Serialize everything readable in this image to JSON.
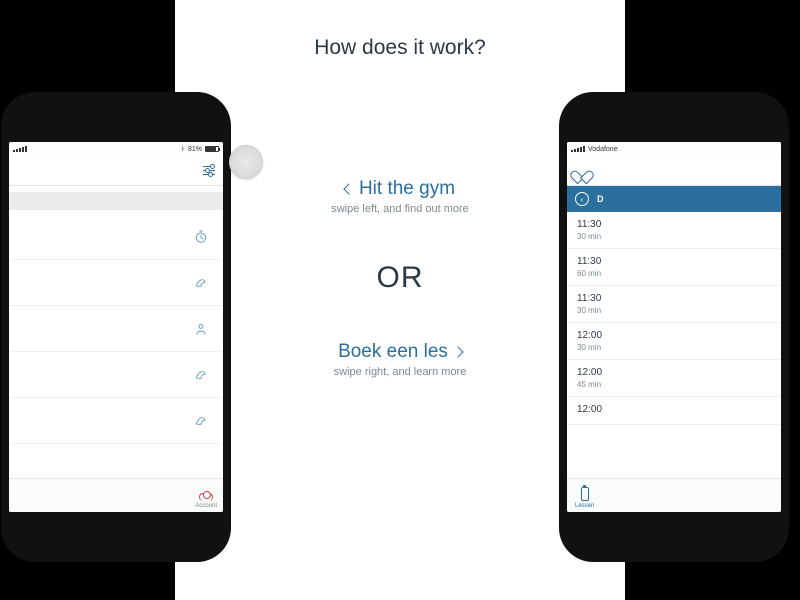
{
  "heading": "How does it work?",
  "center": {
    "left_cta_title": "Hit the gym",
    "left_cta_sub": "swipe left, and find out more",
    "or": "OR",
    "right_cta_title": "Boek een les",
    "right_cta_sub": "swipe right, and learn more"
  },
  "left_phone": {
    "status": {
      "battery": "81%"
    },
    "tabbar": {
      "label": "Account"
    }
  },
  "right_phone": {
    "status": {
      "carrier": "Vodafone"
    },
    "daybar": {
      "letter": "D"
    },
    "rows": [
      {
        "time": "11:30",
        "dur": "30 min"
      },
      {
        "time": "11:30",
        "dur": "60 min"
      },
      {
        "time": "11:30",
        "dur": "30 min"
      },
      {
        "time": "12:00",
        "dur": "30 min"
      },
      {
        "time": "12:00",
        "dur": "45 min"
      },
      {
        "time": "12:00",
        "dur": ""
      }
    ],
    "tabbar": {
      "label": "Lessen"
    }
  }
}
